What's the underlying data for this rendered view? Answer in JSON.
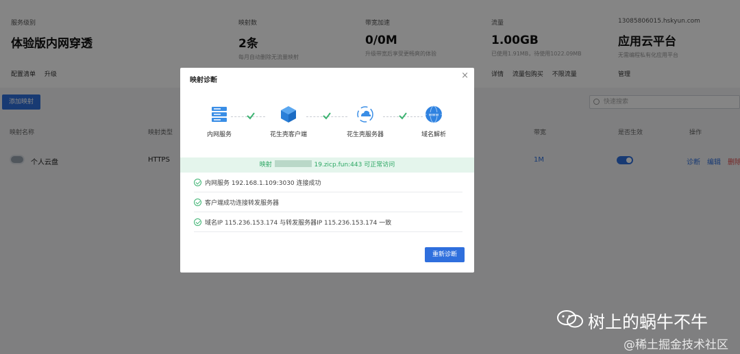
{
  "stats": [
    {
      "label": "服务级别",
      "value": "体验版内网穿透",
      "sub": ""
    },
    {
      "label": "映射数",
      "value": "2条",
      "sub": "每月自动删除无流量映射"
    },
    {
      "label": "带宽加速",
      "value": "0/0M",
      "sub": "升级带宽后享受更畅爽的体验"
    },
    {
      "label": "流量",
      "value": "1.00GB",
      "sub": "已使用1.91MB，待使用1022.09MB"
    },
    {
      "label": "13085806015.hskyun.com",
      "value": "应用云平台",
      "sub": "无需编程私有化应用平台"
    }
  ],
  "stat_links": {
    "service": [
      "配置清单",
      "升级"
    ],
    "traffic": [
      "详情",
      "流量包购买",
      "不限流量"
    ],
    "platform": [
      "管理"
    ]
  },
  "toolbar": {
    "add_label": "添加映射",
    "search_placeholder": "快速搜索"
  },
  "table": {
    "headers": [
      "映射名称",
      "映射类型",
      "带宽",
      "是否生效",
      "操作"
    ],
    "row": {
      "name": "个人云盘",
      "type": "HTTPS",
      "bandwidth": "1M",
      "actions": [
        "诊断",
        "编辑",
        "删除"
      ]
    }
  },
  "modal": {
    "title": "映射诊断",
    "close": "×",
    "steps": [
      {
        "label": "内网服务",
        "icon": "server-icon"
      },
      {
        "label": "花生壳客户端",
        "icon": "cube-icon"
      },
      {
        "label": "花生壳服务器",
        "icon": "cloud-sync-icon"
      },
      {
        "label": "域名解析",
        "icon": "www-globe-icon"
      }
    ],
    "banner_prefix": "映射",
    "banner_suffix": "19.zicp.fun:443 可正常访问",
    "checks": [
      "内网服务 192.168.1.109:3030 连接成功",
      "客户端成功连接转发服务器",
      "域名IP 115.236.153.174 与转发服务器IP 115.236.153.174 一致"
    ],
    "rediagnose_label": "重新诊断"
  },
  "watermark": {
    "title": "树上的蜗牛不牛",
    "sub": "@稀土掘金技术社区"
  },
  "colors": {
    "primary": "#2f6fdd",
    "success": "#3cb371",
    "banner_bg": "#e4f5ec"
  }
}
